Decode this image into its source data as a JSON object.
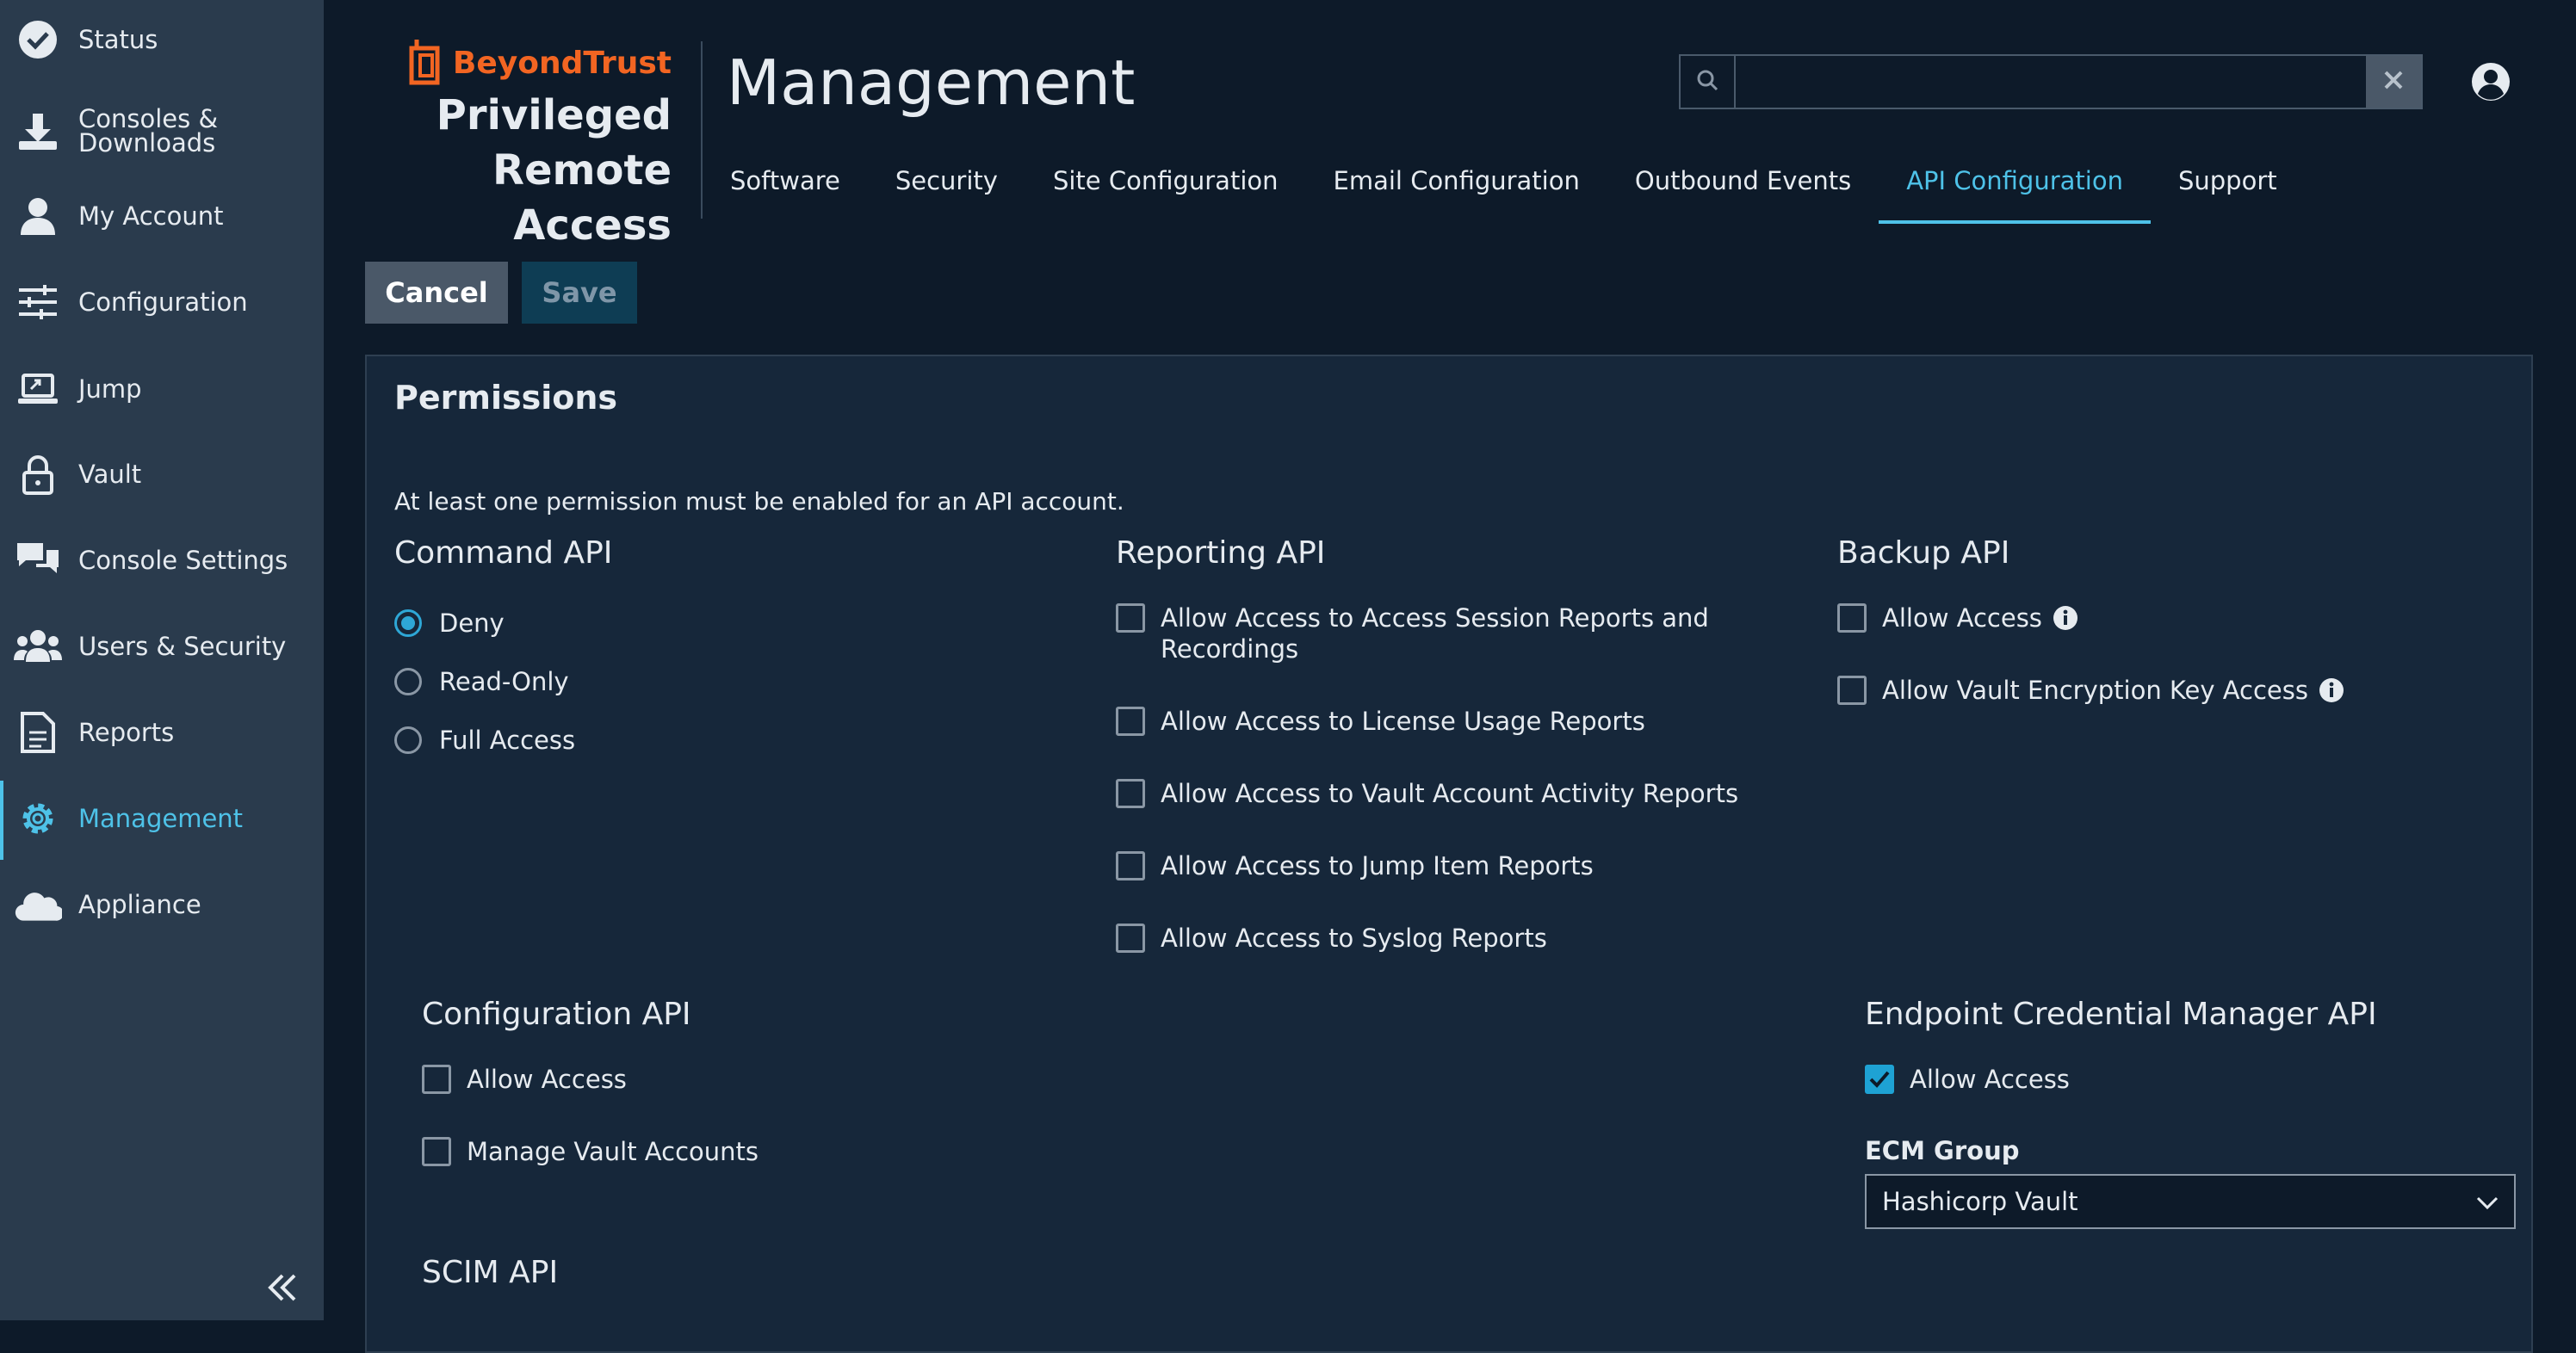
{
  "sidebar": {
    "items": [
      {
        "label": "Status",
        "icon": "check-circle-icon"
      },
      {
        "label": "Consoles &\nDownloads",
        "icon": "download-icon"
      },
      {
        "label": "My Account",
        "icon": "user-icon"
      },
      {
        "label": "Configuration",
        "icon": "sliders-icon"
      },
      {
        "label": "Jump",
        "icon": "laptop-icon"
      },
      {
        "label": "Vault",
        "icon": "lock-icon"
      },
      {
        "label": "Console Settings",
        "icon": "chat-bubbles-icon"
      },
      {
        "label": "Users & Security",
        "icon": "users-icon"
      },
      {
        "label": "Reports",
        "icon": "report-icon"
      },
      {
        "label": "Management",
        "icon": "gear-icon",
        "active": true
      },
      {
        "label": "Appliance",
        "icon": "cloud-icon"
      }
    ],
    "collapse_icon": "double-chevron-left-icon"
  },
  "header": {
    "brand_name": "BeyondTrust",
    "product_line1": "Privileged",
    "product_line2": "Remote Access",
    "page_title": "Management",
    "search": {
      "value": "",
      "placeholder": ""
    },
    "tabs": [
      {
        "label": "Software"
      },
      {
        "label": "Security"
      },
      {
        "label": "Site Configuration"
      },
      {
        "label": "Email Configuration"
      },
      {
        "label": "Outbound Events"
      },
      {
        "label": "API Configuration",
        "active": true
      },
      {
        "label": "Support"
      }
    ]
  },
  "actions": {
    "cancel": "Cancel",
    "save": "Save"
  },
  "permissions": {
    "title": "Permissions",
    "note": "At least one permission must be enabled for an API account.",
    "command_api": {
      "title": "Command API",
      "options": [
        "Deny",
        "Read-Only",
        "Full Access"
      ],
      "selected": "Deny"
    },
    "reporting_api": {
      "title": "Reporting API",
      "options": [
        "Allow Access to Access Session Reports and Recordings",
        "Allow Access to License Usage Reports",
        "Allow Access to Vault Account Activity Reports",
        "Allow Access to Jump Item Reports",
        "Allow Access to Syslog Reports"
      ]
    },
    "backup_api": {
      "title": "Backup API",
      "options": [
        "Allow Access",
        "Allow Vault Encryption Key Access"
      ]
    },
    "configuration_api": {
      "title": "Configuration API",
      "options": [
        "Allow Access",
        "Manage Vault Accounts"
      ]
    },
    "ecm_api": {
      "title": "Endpoint Credential Manager API",
      "allow_access": "Allow Access",
      "allow_access_checked": true,
      "group_label": "ECM Group",
      "group_value": "Hashicorp Vault"
    },
    "scim_api": {
      "title": "SCIM API"
    }
  },
  "colors": {
    "accent": "#4ec2e8",
    "brand": "#f26522",
    "sidebar": "#2a3b4d",
    "panel": "#16273a"
  }
}
